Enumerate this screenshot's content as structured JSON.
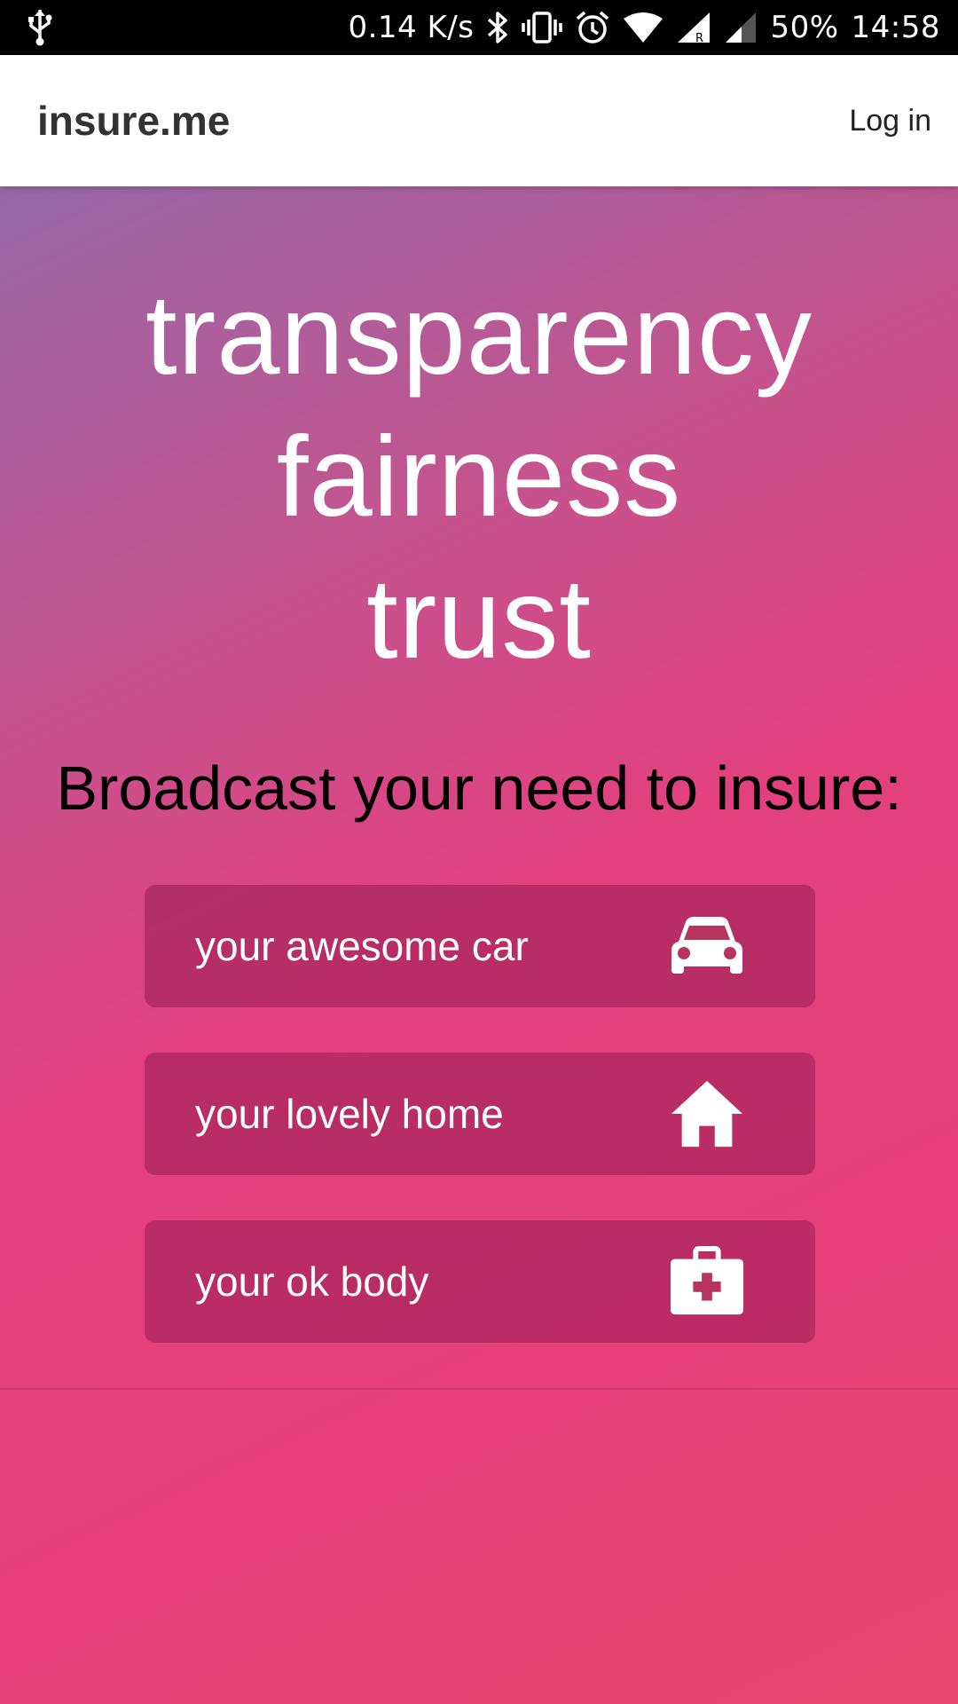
{
  "status_bar": {
    "net_speed": "0.14 K/s",
    "battery": "50%",
    "time": "14:58",
    "icons": [
      "usb-icon",
      "bluetooth-icon",
      "vibrate-icon",
      "alarm-icon",
      "wifi-icon",
      "signal-r-icon",
      "signal-icon"
    ]
  },
  "header": {
    "brand": "insure.me",
    "login": "Log in"
  },
  "hero": {
    "values": [
      "transparency",
      "fairness",
      "trust"
    ],
    "subtitle": "Broadcast your need to insure:"
  },
  "options": [
    {
      "label": "your awesome car",
      "icon": "car-icon"
    },
    {
      "label": "your lovely home",
      "icon": "home-icon"
    },
    {
      "label": "your ok body",
      "icon": "medical-kit-icon"
    }
  ],
  "colors": {
    "gradient_start": "#9769a7",
    "gradient_end": "#e74971",
    "button_bg": "rgba(150,30,80,0.55)"
  }
}
